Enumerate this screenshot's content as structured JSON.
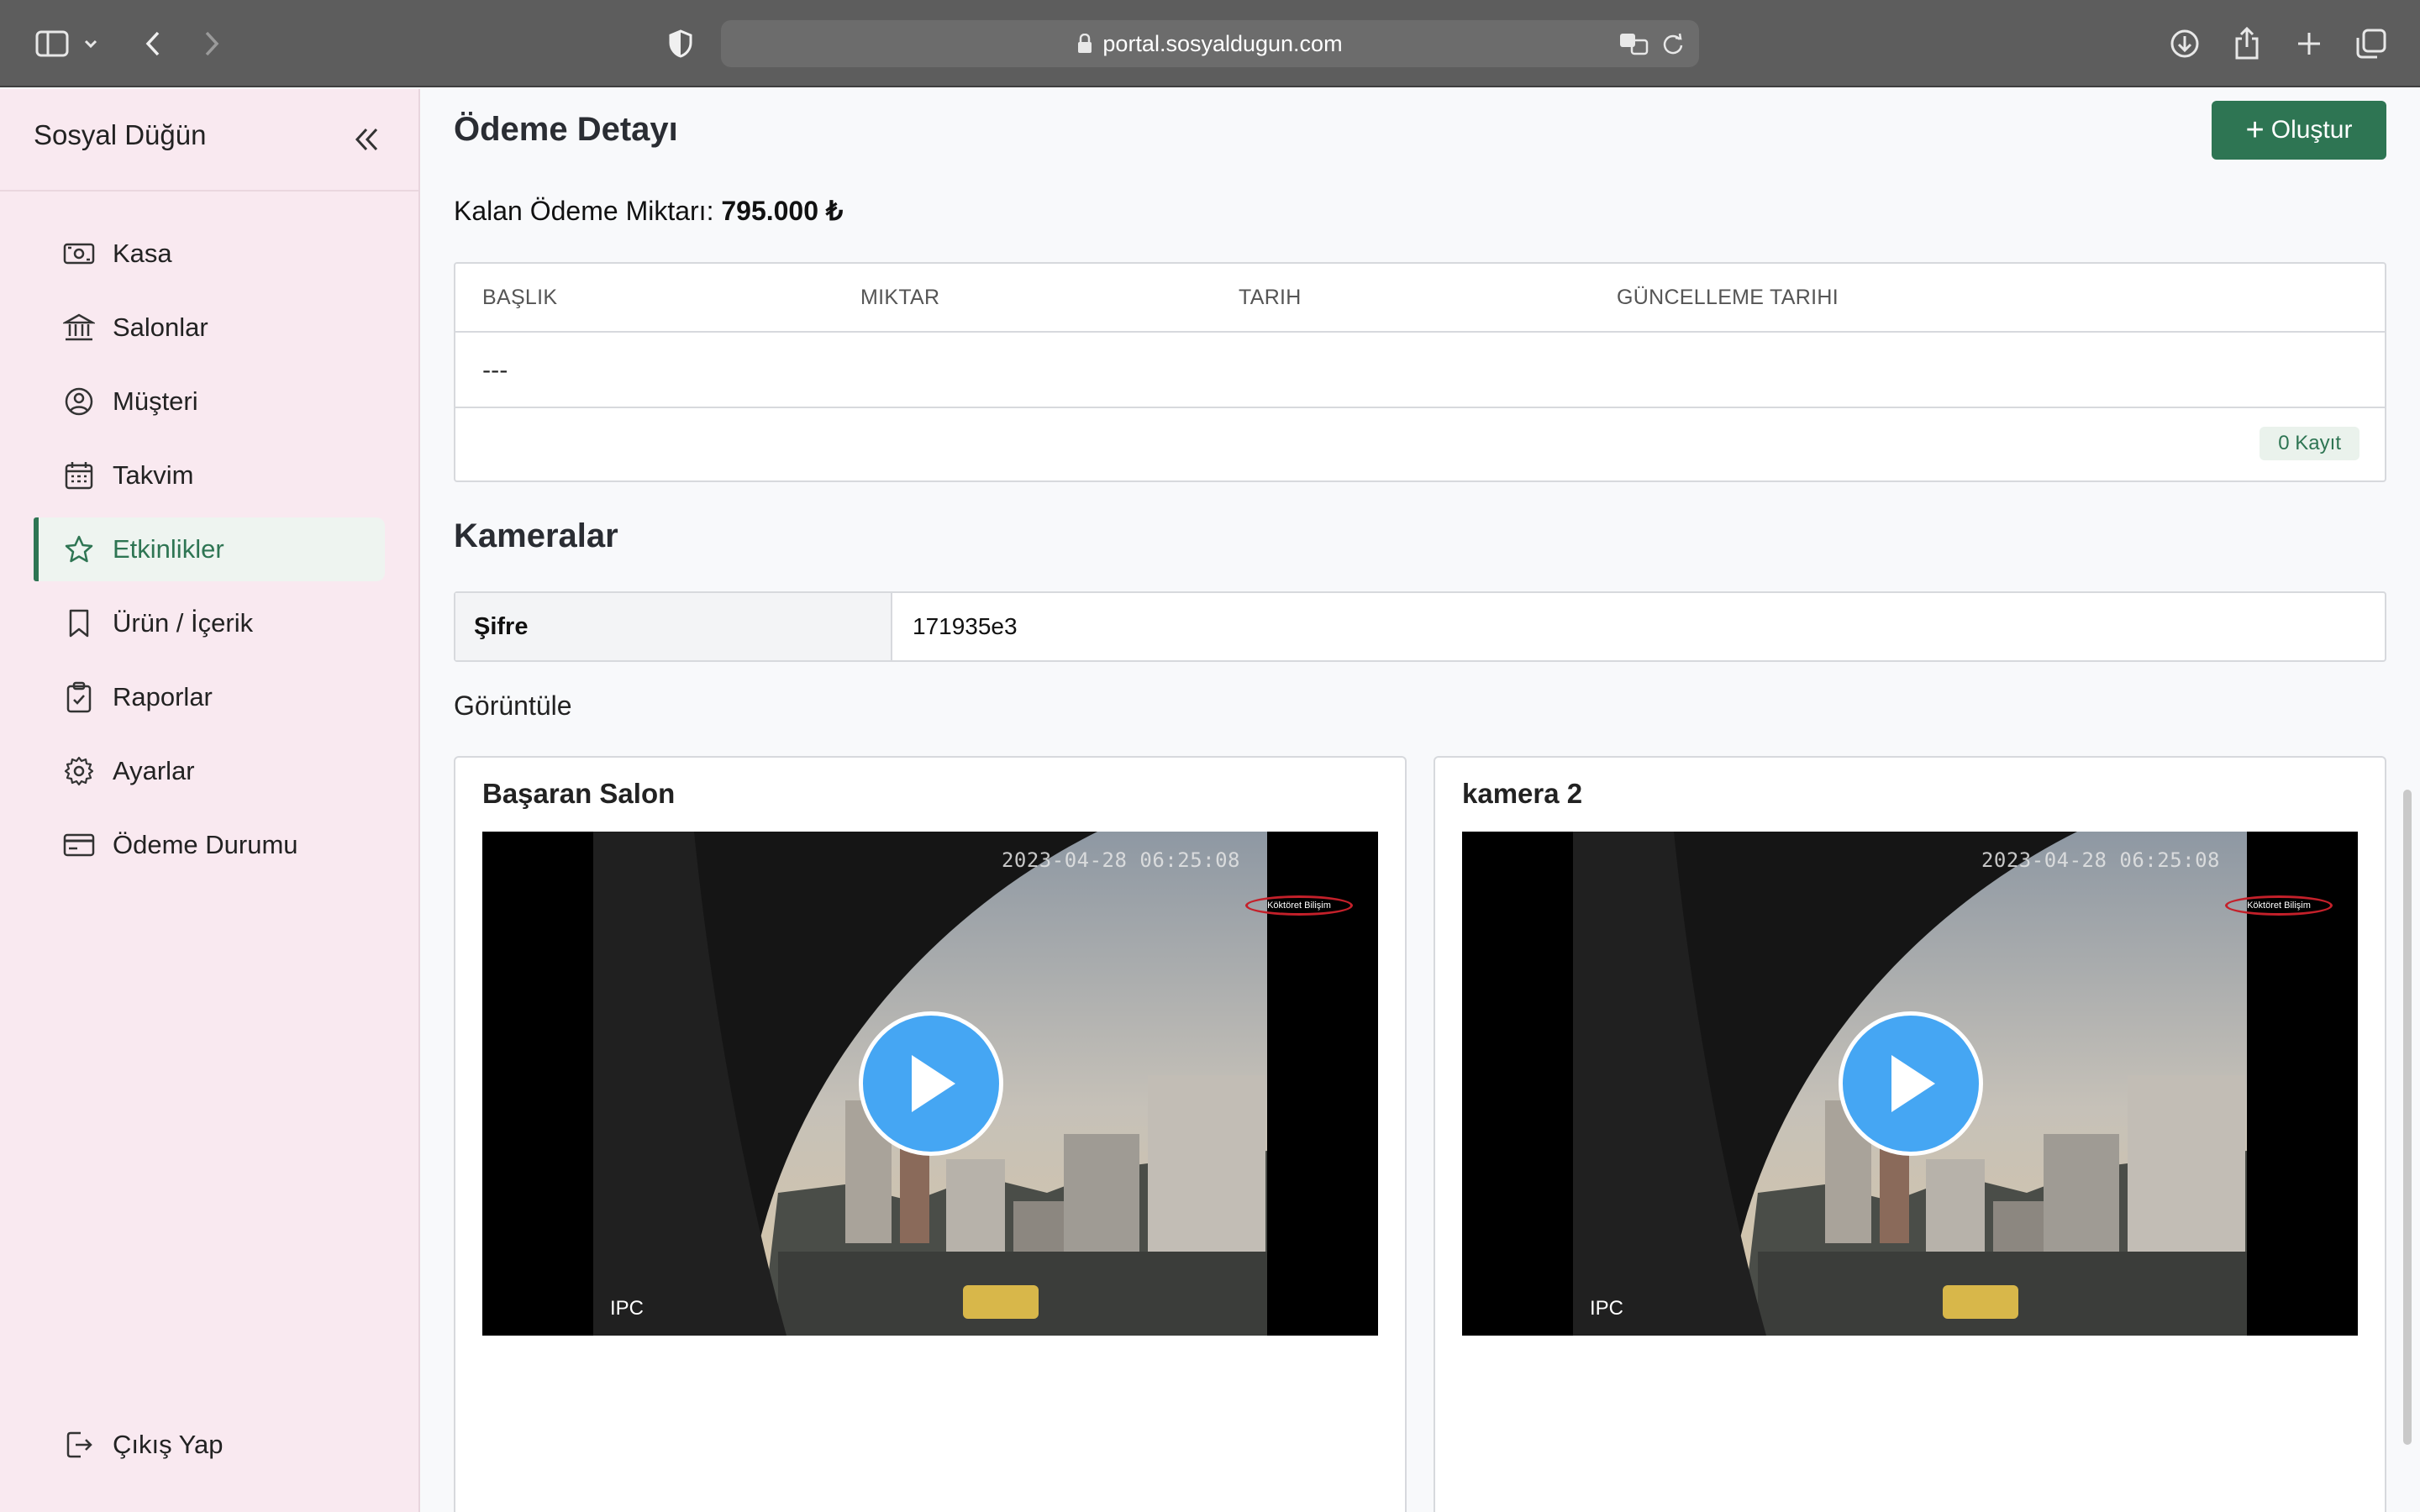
{
  "browser": {
    "url": "portal.sosyaldugun.com"
  },
  "sidebar": {
    "brand": "Sosyal Düğün",
    "items": [
      {
        "label": "Kasa",
        "icon": "cash-icon",
        "active": false
      },
      {
        "label": "Salonlar",
        "icon": "bank-icon",
        "active": false
      },
      {
        "label": "Müşteri",
        "icon": "user-circle-icon",
        "active": false
      },
      {
        "label": "Takvim",
        "icon": "calendar-icon",
        "active": false
      },
      {
        "label": "Etkinlikler",
        "icon": "star-icon",
        "active": true
      },
      {
        "label": "Ürün / İçerik",
        "icon": "bookmark-icon",
        "active": false
      },
      {
        "label": "Raporlar",
        "icon": "clipboard-check-icon",
        "active": false
      },
      {
        "label": "Ayarlar",
        "icon": "gear-icon",
        "active": false
      },
      {
        "label": "Ödeme Durumu",
        "icon": "credit-card-icon",
        "active": false
      }
    ],
    "logout_label": "Çıkış Yap"
  },
  "main": {
    "title": "Ödeme Detayı",
    "create_button": "Oluştur",
    "remaining_label": "Kalan Ödeme Miktarı:",
    "remaining_value": "795.000 ₺",
    "payments_table": {
      "columns": [
        "BAŞLIK",
        "MIKTAR",
        "TARIH",
        "GÜNCELLEME TARIHI"
      ],
      "rows": [
        [
          "---"
        ]
      ],
      "record_count": "0 Kayıt"
    },
    "cameras_title": "Kameralar",
    "password_label": "Şifre",
    "password_value": "171935e3",
    "view_label": "Görüntüle",
    "cameras": [
      {
        "title": "Başaran Salon",
        "timestamp": "2023-04-28 06:25:08",
        "overlay": "IPC",
        "watermark": "Köktöret Bilişim"
      },
      {
        "title": "kamera 2",
        "timestamp": "2023-04-28 06:25:08",
        "overlay": "IPC",
        "watermark": "Köktöret Bilişim"
      }
    ]
  },
  "colors": {
    "accent": "#2e7553",
    "sidebar_bg": "#f9e9f0",
    "play_button": "#45a6f3"
  }
}
